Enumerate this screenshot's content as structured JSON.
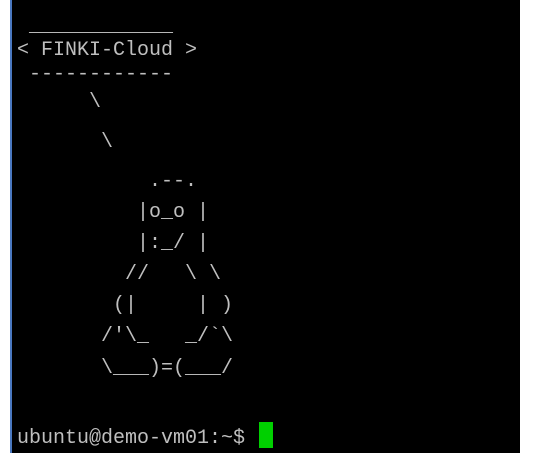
{
  "terminal": {
    "colors": {
      "background": "#000000",
      "foreground": "#bfbfbf",
      "cursor": "#00d000",
      "border": "#4a78c0"
    },
    "ascii_art": [
      " ____________",
      "< FINKI-Cloud >",
      " ------------",
      "      \\",
      "       \\",
      "           .--.",
      "          |o_o |",
      "          |:_/ |",
      "         //   \\ \\",
      "        (|     | )",
      "       /'\\_   _/`\\",
      "       \\___)=(___/"
    ],
    "prompt": "ubuntu@demo-vm01:~$ "
  }
}
